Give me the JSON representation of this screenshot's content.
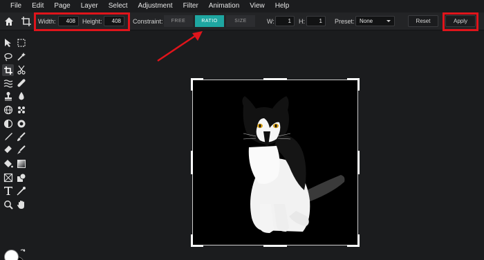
{
  "menu": [
    "File",
    "Edit",
    "Page",
    "Layer",
    "Select",
    "Adjustment",
    "Filter",
    "Animation",
    "View",
    "Help"
  ],
  "options": {
    "width_label": "Width:",
    "width_value": "408",
    "height_label": "Height:",
    "height_value": "408",
    "constraint_label": "Constraint:",
    "constraint_options": [
      "FREE",
      "RATIO",
      "SIZE"
    ],
    "constraint_selected": "RATIO",
    "w_label": "W:",
    "w_value": "1",
    "h_label": "H:",
    "h_value": "1",
    "preset_label": "Preset:",
    "preset_value": "None",
    "reset_label": "Reset",
    "apply_label": "Apply"
  },
  "tools": [
    "select-arrow",
    "marquee",
    "lasso",
    "magic-wand",
    "crop",
    "cut",
    "liquify",
    "heal",
    "clone-stamp",
    "blur",
    "sphere",
    "spot",
    "dodge-burn",
    "sponge",
    "pen",
    "brush",
    "eraser",
    "replace-color",
    "bucket",
    "gradient",
    "frame",
    "shape",
    "text",
    "eyedropper",
    "zoom",
    "hand"
  ],
  "colors": {
    "accent": "#1ea6a1",
    "highlight": "#e0141b",
    "foreground": "#ffffff",
    "background": "#000000"
  }
}
